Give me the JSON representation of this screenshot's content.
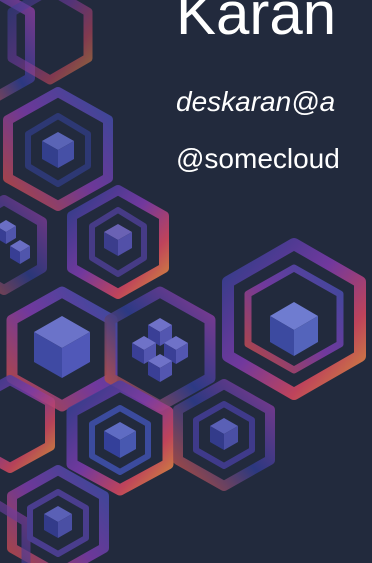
{
  "slide": {
    "title": "Karan",
    "email": "deskaran@a",
    "handle": "@somecloud"
  },
  "colors": {
    "background": "#222a3d",
    "text": "#ffffff",
    "hex_gradient": [
      "#2c3f8f",
      "#7a3aa8",
      "#d0465e",
      "#e59a3a"
    ]
  },
  "icons": [
    "hexagon-pattern",
    "cube-icon",
    "multi-cube-icon"
  ]
}
